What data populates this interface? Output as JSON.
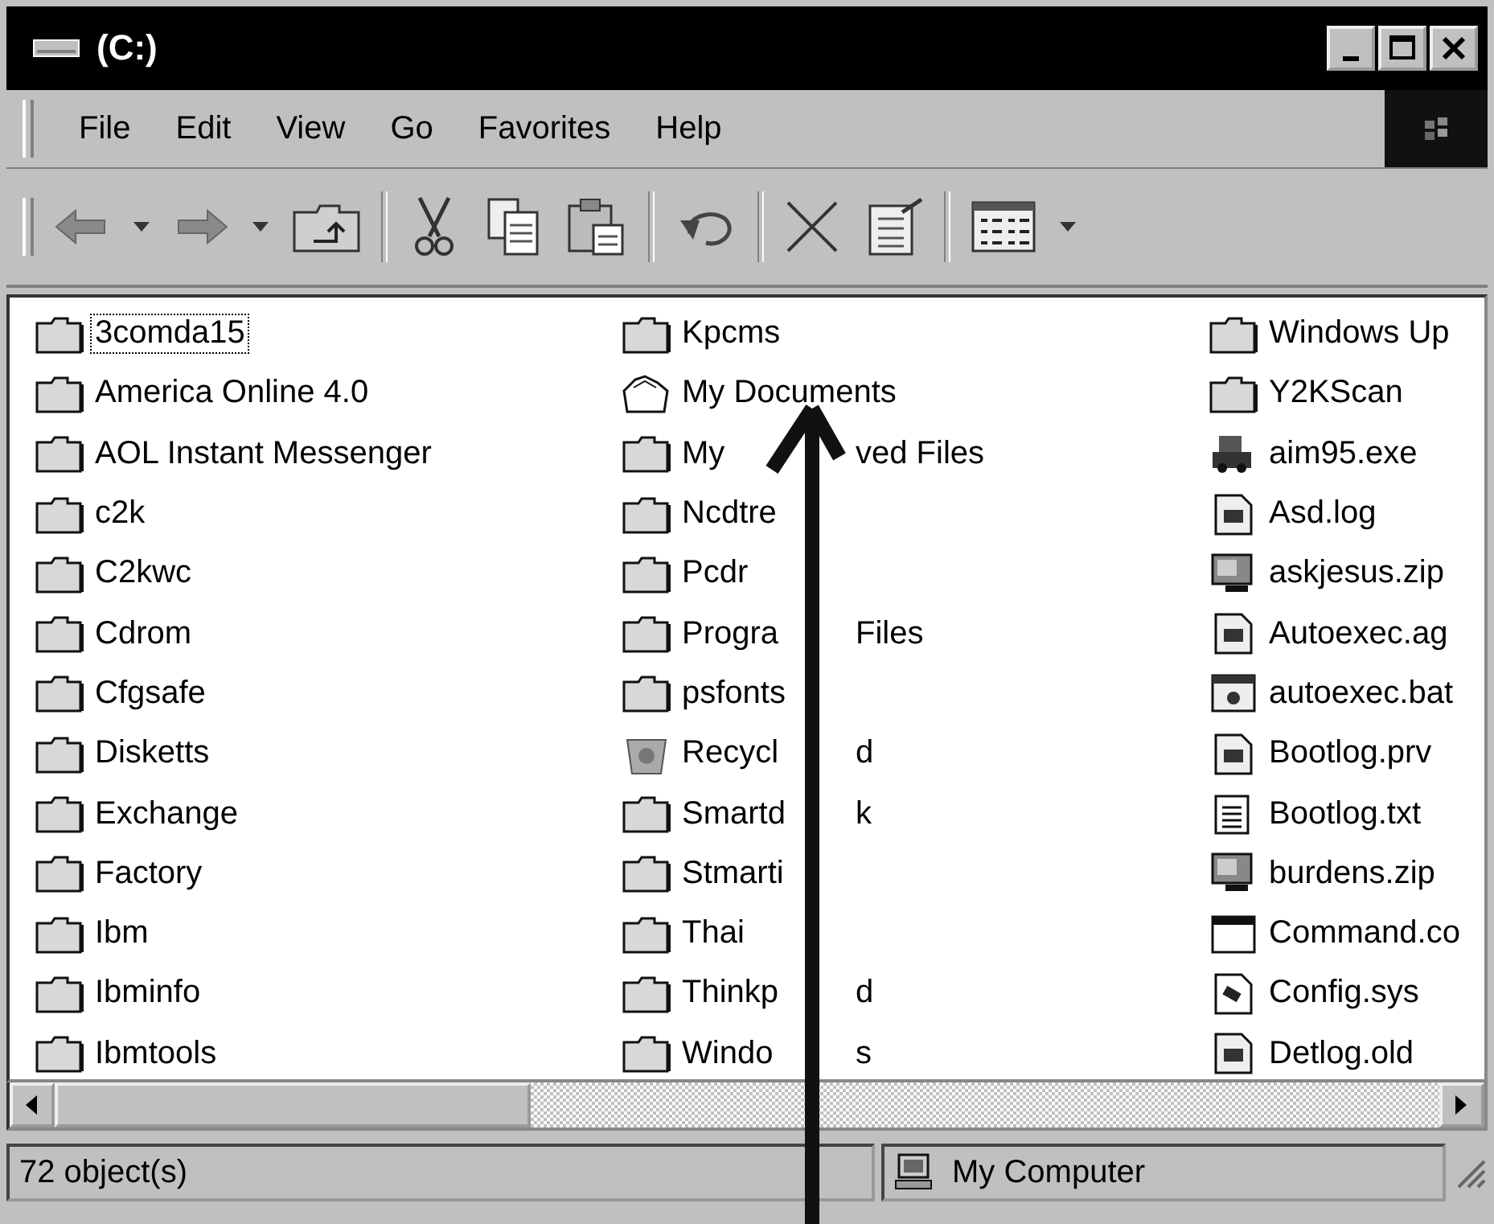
{
  "window": {
    "title": "(C:)"
  },
  "menu": [
    {
      "label": "File"
    },
    {
      "label": "Edit"
    },
    {
      "label": "View"
    },
    {
      "label": "Go"
    },
    {
      "label": "Favorites"
    },
    {
      "label": "Help"
    }
  ],
  "items": [
    {
      "name": "3comda15",
      "kind": "folder",
      "focused": true
    },
    {
      "name": "America Online 4.0",
      "kind": "folder",
      "focused": false
    },
    {
      "name": "AOL Instant Messenger",
      "kind": "folder",
      "focused": false
    },
    {
      "name": "c2k",
      "kind": "folder",
      "focused": false
    },
    {
      "name": "C2kwc",
      "kind": "folder",
      "focused": false
    },
    {
      "name": "Cdrom",
      "kind": "folder",
      "focused": false
    },
    {
      "name": "Cfgsafe",
      "kind": "folder",
      "focused": false
    },
    {
      "name": "Disketts",
      "kind": "folder",
      "focused": false
    },
    {
      "name": "Exchange",
      "kind": "folder",
      "focused": false
    },
    {
      "name": "Factory",
      "kind": "folder",
      "focused": false
    },
    {
      "name": "Ibm",
      "kind": "folder",
      "focused": false
    },
    {
      "name": "Ibminfo",
      "kind": "folder",
      "focused": false
    },
    {
      "name": "Ibmtools",
      "kind": "folder",
      "focused": false
    },
    {
      "name": "Kpcms",
      "kind": "folder",
      "focused": false
    },
    {
      "name": "My Documents",
      "kind": "documents",
      "focused": false
    },
    {
      "name": "My",
      "name_tail": "ved Files",
      "kind": "folder",
      "focused": false
    },
    {
      "name": "Ncdtre",
      "kind": "folder",
      "focused": false
    },
    {
      "name": "Pcdr",
      "kind": "folder",
      "focused": false
    },
    {
      "name": "Progra",
      "name_tail": "Files",
      "kind": "folder",
      "focused": false
    },
    {
      "name": "psfonts",
      "kind": "folder",
      "focused": false
    },
    {
      "name": "Recycl",
      "name_tail": "d",
      "kind": "recycle",
      "focused": false
    },
    {
      "name": "Smartd",
      "name_tail": "k",
      "kind": "folder",
      "focused": false
    },
    {
      "name": "Stmarti",
      "kind": "folder",
      "focused": false
    },
    {
      "name": "Thai",
      "kind": "folder",
      "focused": false
    },
    {
      "name": "Thinkp",
      "name_tail": "d",
      "kind": "folder",
      "focused": false
    },
    {
      "name": "Windo",
      "name_tail": "s",
      "kind": "folder",
      "focused": false
    },
    {
      "name": "Windows Up",
      "kind": "folder",
      "focused": false
    },
    {
      "name": "Y2KScan",
      "kind": "folder",
      "focused": false
    },
    {
      "name": "aim95.exe",
      "kind": "program",
      "focused": false
    },
    {
      "name": "Asd.log",
      "kind": "log",
      "focused": false
    },
    {
      "name": "askjesus.zip",
      "kind": "zip",
      "focused": false
    },
    {
      "name": "Autoexec.ag",
      "kind": "log",
      "focused": false
    },
    {
      "name": "autoexec.bat",
      "kind": "batch",
      "focused": false
    },
    {
      "name": "Bootlog.prv",
      "kind": "log",
      "focused": false
    },
    {
      "name": "Bootlog.txt",
      "kind": "text",
      "focused": false
    },
    {
      "name": "burdens.zip",
      "kind": "zip",
      "focused": false
    },
    {
      "name": "Command.co",
      "kind": "command",
      "focused": false
    },
    {
      "name": "Config.sys",
      "kind": "system",
      "focused": false
    },
    {
      "name": "Detlog.old",
      "kind": "log",
      "focused": false
    }
  ],
  "status_bar": {
    "objects": "72 object(s)",
    "location": "My Computer"
  }
}
